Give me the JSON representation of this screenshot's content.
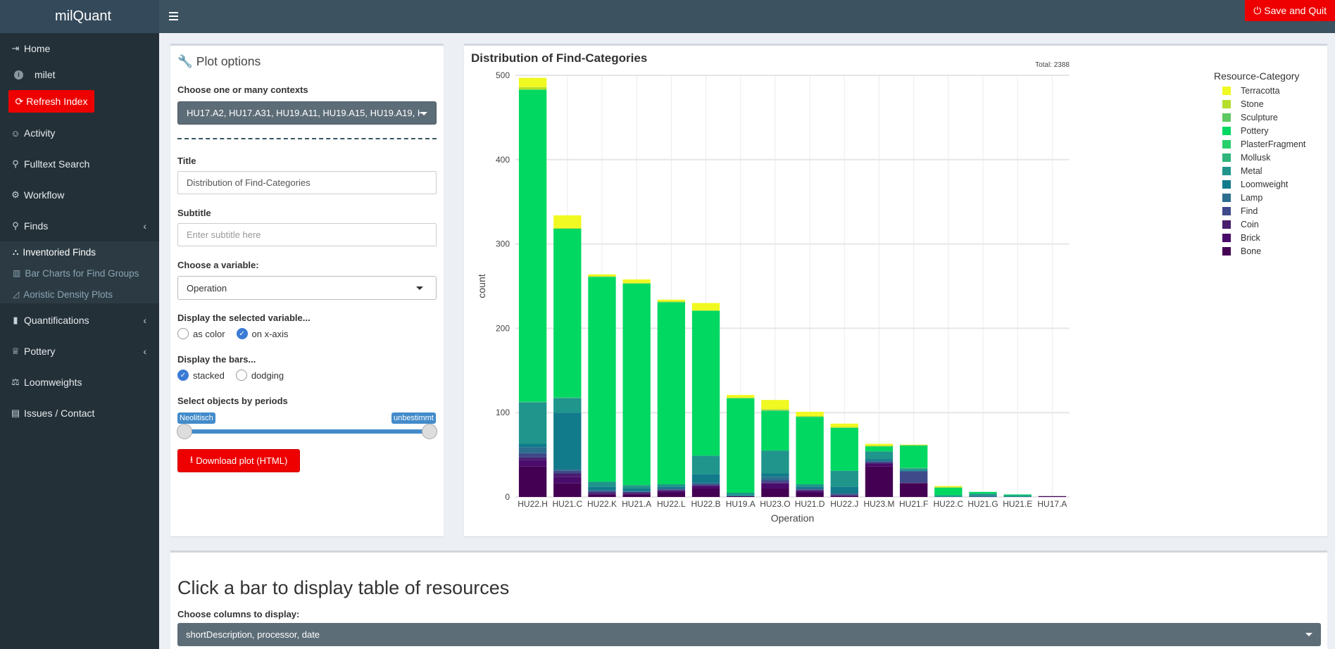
{
  "header": {
    "app_title": "milQuant",
    "save_quit_label": "Save and Quit"
  },
  "sidebar": {
    "home": "Home",
    "user": "milet",
    "refresh": "Refresh Index",
    "activity": "Activity",
    "fulltext": "Fulltext Search",
    "workflow": "Workflow",
    "finds": "Finds",
    "sub": {
      "inventoried": "Inventoried Finds",
      "barcharts": "Bar Charts for Find Groups",
      "aoristic": "Aoristic Density Plots"
    },
    "quantifications": "Quantifications",
    "pottery": "Pottery",
    "loomweights": "Loomweights",
    "issues": "Issues / Contact"
  },
  "options": {
    "title": "Plot options",
    "contexts_label": "Choose one or many contexts",
    "contexts_value": "HU17.A2, HU17.A31, HU19.A11, HU19.A15, HU19.A19, HU",
    "title_label": "Title",
    "title_value": "Distribution of Find-Categories",
    "subtitle_label": "Subtitle",
    "subtitle_placeholder": "Enter subtitle here",
    "variable_label": "Choose a variable:",
    "variable_value": "Operation",
    "display_var_label": "Display the selected variable...",
    "as_color": "as color",
    "on_xaxis": "on x-axis",
    "display_bars_label": "Display the bars...",
    "stacked": "stacked",
    "dodging": "dodging",
    "periods_label": "Select objects by periods",
    "period_from": "Neolitisch",
    "period_to": "unbestimmt",
    "download_label": "Download plot (HTML)"
  },
  "chart_data": {
    "type": "bar",
    "title": "Distribution of Find-Categories",
    "xlabel": "Operation",
    "ylabel": "count",
    "ylim": [
      0,
      500
    ],
    "yticks": [
      0,
      100,
      200,
      300,
      400,
      500
    ],
    "total_label": "Total: 2388",
    "legend_title": "Resource-Category",
    "legend_position": "right",
    "categories": [
      "HU22.H",
      "HU21.C",
      "HU22.K",
      "HU21.A",
      "HU22.L",
      "HU22.B",
      "HU19.A",
      "HU23.O",
      "HU21.D",
      "HU22.J",
      "HU23.M",
      "HU21.F",
      "HU22.C",
      "HU21.G",
      "HU21.E",
      "HU17.A"
    ],
    "series": [
      {
        "name": "Bone",
        "color": "#440154",
        "values": [
          36,
          16,
          3,
          3,
          5,
          10,
          1,
          10,
          5,
          1,
          36,
          16,
          0,
          0,
          0,
          1
        ]
      },
      {
        "name": "Brick",
        "color": "#4a0c6b",
        "values": [
          8,
          8,
          1,
          1,
          2,
          3,
          0,
          6,
          2,
          1,
          4,
          0,
          0,
          0,
          0,
          0
        ]
      },
      {
        "name": "Coin",
        "color": "#481d6f",
        "values": [
          3,
          4,
          1,
          1,
          1,
          1,
          0,
          1,
          1,
          0,
          0,
          1,
          0,
          0,
          0,
          0
        ]
      },
      {
        "name": "Find",
        "color": "#3e4a89",
        "values": [
          5,
          3,
          2,
          1,
          1,
          1,
          0,
          3,
          1,
          1,
          2,
          13,
          0,
          0,
          0,
          0
        ]
      },
      {
        "name": "Lamp",
        "color": "#2c6e8e",
        "values": [
          7,
          2,
          1,
          1,
          1,
          2,
          0,
          4,
          1,
          2,
          1,
          1,
          0,
          1,
          0,
          0
        ]
      },
      {
        "name": "Loomweight",
        "color": "#117a8b",
        "values": [
          4,
          67,
          4,
          3,
          2,
          10,
          1,
          4,
          2,
          7,
          2,
          1,
          0,
          1,
          0,
          0
        ]
      },
      {
        "name": "Metal",
        "color": "#1f958b",
        "values": [
          49,
          17,
          6,
          4,
          3,
          22,
          3,
          27,
          3,
          19,
          9,
          2,
          2,
          2,
          2,
          0
        ]
      },
      {
        "name": "Mollusk",
        "color": "#2fb47c",
        "values": [
          1,
          1,
          0,
          0,
          0,
          0,
          0,
          0,
          0,
          0,
          0,
          0,
          0,
          0,
          0,
          0
        ]
      },
      {
        "name": "PlasterFragment",
        "color": "#27d06a",
        "values": [
          0,
          0,
          0,
          0,
          0,
          0,
          0,
          0,
          0,
          0,
          0,
          1,
          0,
          0,
          0,
          0
        ]
      },
      {
        "name": "Pottery",
        "color": "#00d862",
        "values": [
          370,
          200,
          243,
          239,
          216,
          172,
          112,
          47,
          80,
          51,
          6,
          26,
          9,
          2,
          1,
          0
        ]
      },
      {
        "name": "Sculpture",
        "color": "#5ec962",
        "values": [
          0,
          0,
          0,
          0,
          0,
          0,
          0,
          1,
          0,
          0,
          0,
          0,
          0,
          0,
          0,
          0
        ]
      },
      {
        "name": "Stone",
        "color": "#b5de2b",
        "values": [
          3,
          1,
          1,
          1,
          1,
          0,
          1,
          1,
          1,
          1,
          1,
          1,
          1,
          0,
          0,
          0
        ]
      },
      {
        "name": "Terracotta",
        "color": "#f0f921",
        "values": [
          11,
          15,
          2,
          4,
          2,
          9,
          3,
          11,
          5,
          4,
          2,
          0,
          1,
          0,
          0,
          0
        ]
      }
    ]
  },
  "bottom": {
    "title": "Click a bar to display table of resources",
    "columns_label": "Choose columns to display:",
    "columns_value": "shortDescription, processor, date"
  }
}
